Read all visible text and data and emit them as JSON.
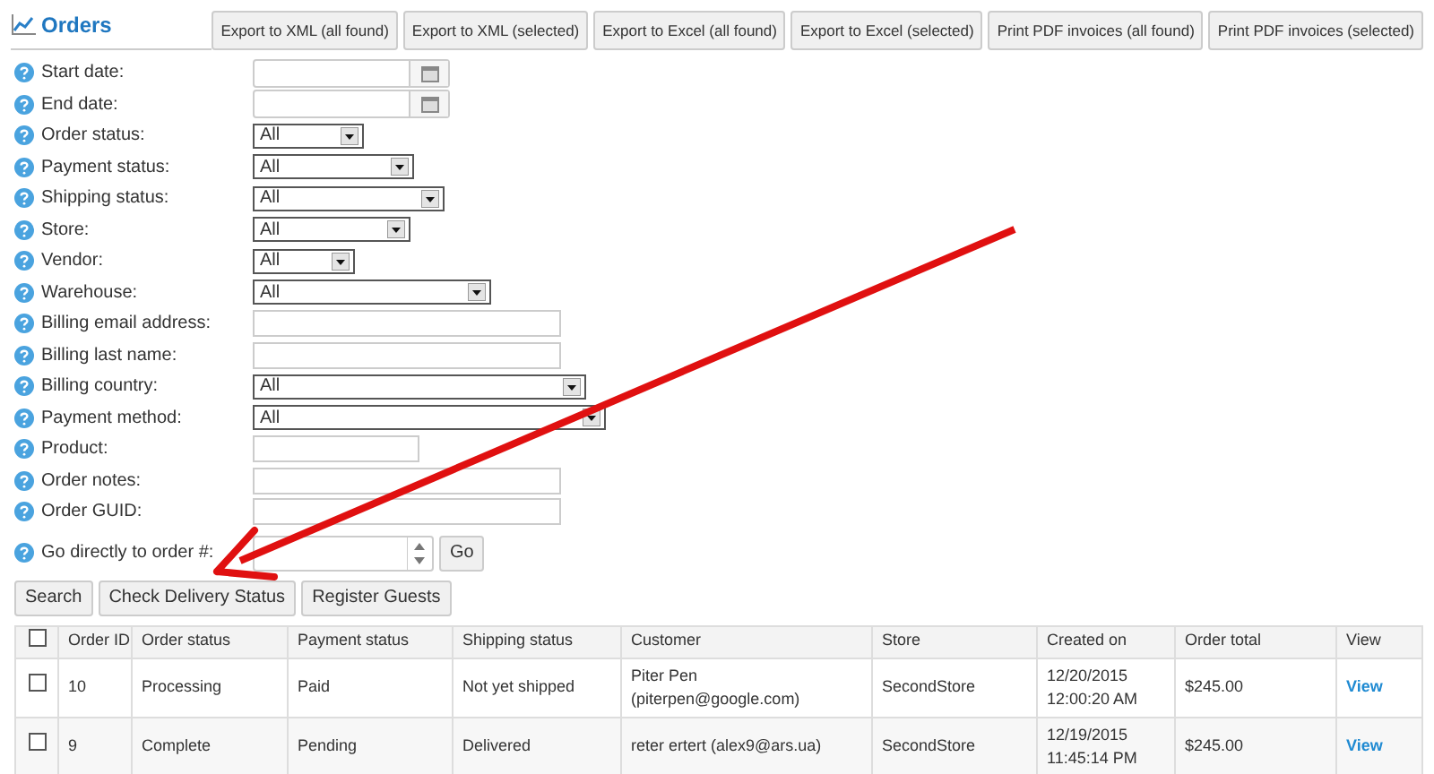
{
  "header": {
    "title": "Orders"
  },
  "toolbar_buttons": [
    "Export to XML (all found)",
    "Export to XML (selected)",
    "Export to Excel (all found)",
    "Export to Excel (selected)",
    "Print PDF invoices (all found)",
    "Print PDF invoices (selected)"
  ],
  "filters": [
    {
      "kind": "date",
      "label": "Start date:"
    },
    {
      "kind": "date",
      "label": "End date:"
    },
    {
      "kind": "select",
      "label": "Order status:",
      "value": "All"
    },
    {
      "kind": "select",
      "label": "Payment status:",
      "value": "All"
    },
    {
      "kind": "select",
      "label": "Shipping status:",
      "value": "All"
    },
    {
      "kind": "select",
      "label": "Store:",
      "value": "All"
    },
    {
      "kind": "select",
      "label": "Vendor:",
      "value": "All"
    },
    {
      "kind": "select",
      "label": "Warehouse:",
      "value": "All"
    },
    {
      "kind": "text",
      "label": "Billing email address:"
    },
    {
      "kind": "text",
      "label": "Billing last name:"
    },
    {
      "kind": "select",
      "label": "Billing country:",
      "value": "All"
    },
    {
      "kind": "select",
      "label": "Payment method:",
      "value": "All"
    },
    {
      "kind": "text",
      "label": "Product:"
    },
    {
      "kind": "text",
      "label": "Order notes:"
    },
    {
      "kind": "text",
      "label": "Order GUID:"
    },
    {
      "kind": "number",
      "label": "Go directly to order #:",
      "button": "Go"
    }
  ],
  "action_buttons": [
    "Search",
    "Check Delivery Status",
    "Register Guests"
  ],
  "table": {
    "select_all_checked": false,
    "columns": [
      "Order ID",
      "Order status",
      "Payment status",
      "Shipping status",
      "Customer",
      "Store",
      "Created on",
      "Order total",
      "View"
    ],
    "rows": [
      {
        "checked": false,
        "cells": [
          "10",
          "Processing",
          "Paid",
          "Not yet shipped",
          "Piter Pen (piterpen@google.com)",
          "SecondStore",
          "12/20/2015 12:00:20 AM",
          "$245.00"
        ],
        "link": "View"
      },
      {
        "checked": false,
        "cells": [
          "9",
          "Complete",
          "Pending",
          "Delivered",
          "reter ertert (alex9@ars.ua)",
          "SecondStore",
          "12/19/2015 11:45:14 PM",
          "$245.00"
        ],
        "link": "View"
      }
    ]
  }
}
